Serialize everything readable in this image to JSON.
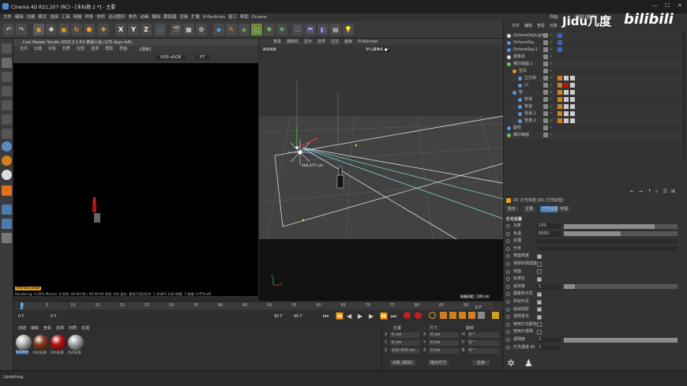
{
  "titlebar": {
    "title": "Cinema 4D R21.207 (RC) - [未标题 2 *] - 主要",
    "watermark_jidu": "Jidu几度",
    "watermark_bili": "bilibili"
  },
  "menu": [
    "文件",
    "编辑",
    "创建",
    "模式",
    "选择",
    "工具",
    "网格",
    "样条",
    "体积",
    "运动图形",
    "角色",
    "动画",
    "模拟",
    "跟踪器",
    "渲染",
    "扩展",
    "X-Particles",
    "窗口",
    "帮助",
    "Octane"
  ],
  "toolbar": {
    "axes": [
      "X",
      "Y",
      "Z"
    ]
  },
  "live_viewer": {
    "title": "Live Viewer Studio 2020.2.1-R3 黄狐小站 (135 days left)",
    "menu": [
      "文件",
      "云端",
      "对象",
      "材质",
      "比较",
      "选项",
      "帮助",
      "界面"
    ],
    "mode": "HDR sRGB",
    "mode2": "PT",
    "channel": "[漫射]",
    "status": "Rendering: 0.00%   Ms/sec: 0   时间: 00:00:00 / 00:00:00   采样: 0/8   显存: 使用/可用/总共: 1.3GB/5.1Gb   网格: 7  纹理: 0   RTX:off",
    "tag": "Infinite Show"
  },
  "viewport": {
    "menu": [
      "查看",
      "摄像机",
      "显示",
      "选项",
      "过滤",
      "面板",
      "ProRender"
    ],
    "view_name": "透视视图",
    "camera": "默认摄像机 ●°",
    "measure": "104.477 cm",
    "grid": "网格间距 : 100 cm",
    "axis_y": "Y",
    "axis_x": "X"
  },
  "timeline": {
    "ticks": [
      "0",
      "5",
      "10",
      "15",
      "20",
      "25",
      "30",
      "35",
      "40",
      "45",
      "50",
      "55",
      "60",
      "65",
      "70",
      "75",
      "80",
      "85",
      "90"
    ],
    "frame_start": "0 F",
    "frame_cur": "0 F",
    "frame_end1": "90 F",
    "frame_end2": "90 F",
    "frame_right": "0 F"
  },
  "materials": {
    "menu": [
      "创建",
      "编辑",
      "查看",
      "选择",
      "材质",
      "纹理"
    ],
    "items": [
      {
        "label": "Octane",
        "color": "#b8b8b8"
      },
      {
        "label": "Oct光泽",
        "color": "#8a3a1e"
      },
      {
        "label": "Oct光泽",
        "color": "#c01010"
      },
      {
        "label": "Oct光泽",
        "color": "#a8a8a8"
      }
    ]
  },
  "coords": {
    "headers": [
      "位置",
      "尺寸",
      "旋转"
    ],
    "rows": [
      {
        "axis": "X",
        "pos": "0 cm",
        "axis2": "X",
        "size": "0 cm",
        "rot_label": "H",
        "rot": "0 °"
      },
      {
        "axis": "Y",
        "pos": "0 cm",
        "axis2": "Y",
        "size": "0 cm",
        "rot_label": "P",
        "rot": "0 °"
      },
      {
        "axis": "Z",
        "pos": "102.415 cm",
        "axis2": "Z",
        "size": "0 cm",
        "rot_label": "B",
        "rot": "0 °"
      }
    ],
    "mode1": "对象 (相对)",
    "mode2": "绝对尺寸",
    "apply": "应用"
  },
  "objects": {
    "menu": [
      "文件",
      "编辑",
      "查看",
      "对象"
    ],
    "layout_label": "界面:",
    "layout_value": "启动 (用户)",
    "items": [
      {
        "label": "OctaneDayLight",
        "indent": 0
      },
      {
        "label": "OctaneSky",
        "indent": 0
      },
      {
        "label": "OctaneSky.1",
        "indent": 0
      },
      {
        "label": "摄像机",
        "indent": 0
      },
      {
        "label": "细分曲面.1",
        "indent": 0
      },
      {
        "label": "空白",
        "indent": 1
      },
      {
        "label": "立方体",
        "indent": 2
      },
      {
        "label": "口",
        "indent": 2
      },
      {
        "label": "管",
        "indent": 1
      },
      {
        "label": "管道",
        "indent": 2
      },
      {
        "label": "管道",
        "indent": 2
      },
      {
        "label": "管道.1",
        "indent": 2
      },
      {
        "label": "管道.2",
        "indent": 2
      },
      {
        "label": "圆柱",
        "indent": 0
      },
      {
        "label": "细分曲面",
        "indent": 0
      }
    ]
  },
  "attributes": {
    "menu": [
      "模式",
      "编辑",
      "用户数据"
    ],
    "object_title": "OC 灯光标签 [OC 灯光标签]",
    "tabs": [
      "基本",
      "主要",
      "灯光设置",
      "可视"
    ],
    "active_tab": "灯光设置",
    "section": "灯光设置",
    "fields": [
      {
        "label": "功率",
        "type": "slider",
        "value": "100.",
        "fill": 0.8
      },
      {
        "label": "色温",
        "type": "slider",
        "value": "6500.",
        "fill": 0.5
      },
      {
        "label": "纹理",
        "type": "bar"
      },
      {
        "label": "分布",
        "type": "bar"
      },
      {
        "label": "表面亮度",
        "type": "check",
        "checked": true
      },
      {
        "label": "保持实例强度",
        "type": "check",
        "checked": false
      },
      {
        "label": "双面",
        "type": "check",
        "checked": false
      },
      {
        "label": "标准化",
        "type": "check",
        "checked": true
      },
      {
        "label": "采样率",
        "type": "slider",
        "value": "1.",
        "fill": 0.1
      },
      {
        "label": "摄像机可见",
        "type": "check",
        "checked": true
      },
      {
        "label": "折射可见",
        "type": "check",
        "checked": true
      },
      {
        "label": "投射阴影",
        "type": "check",
        "checked": true
      },
      {
        "label": "透明发光",
        "type": "check",
        "checked": true
      },
      {
        "label": "使用灯光颜色",
        "type": "check",
        "checked": false
      },
      {
        "label": "使用不透明",
        "type": "check",
        "checked": false
      },
      {
        "label": "透明度",
        "type": "slider",
        "value": "1.",
        "fill": 1.0
      },
      {
        "label": "灯光通道 ID",
        "type": "number",
        "value": "1"
      }
    ]
  },
  "statusbar": {
    "text": "Updating.."
  }
}
